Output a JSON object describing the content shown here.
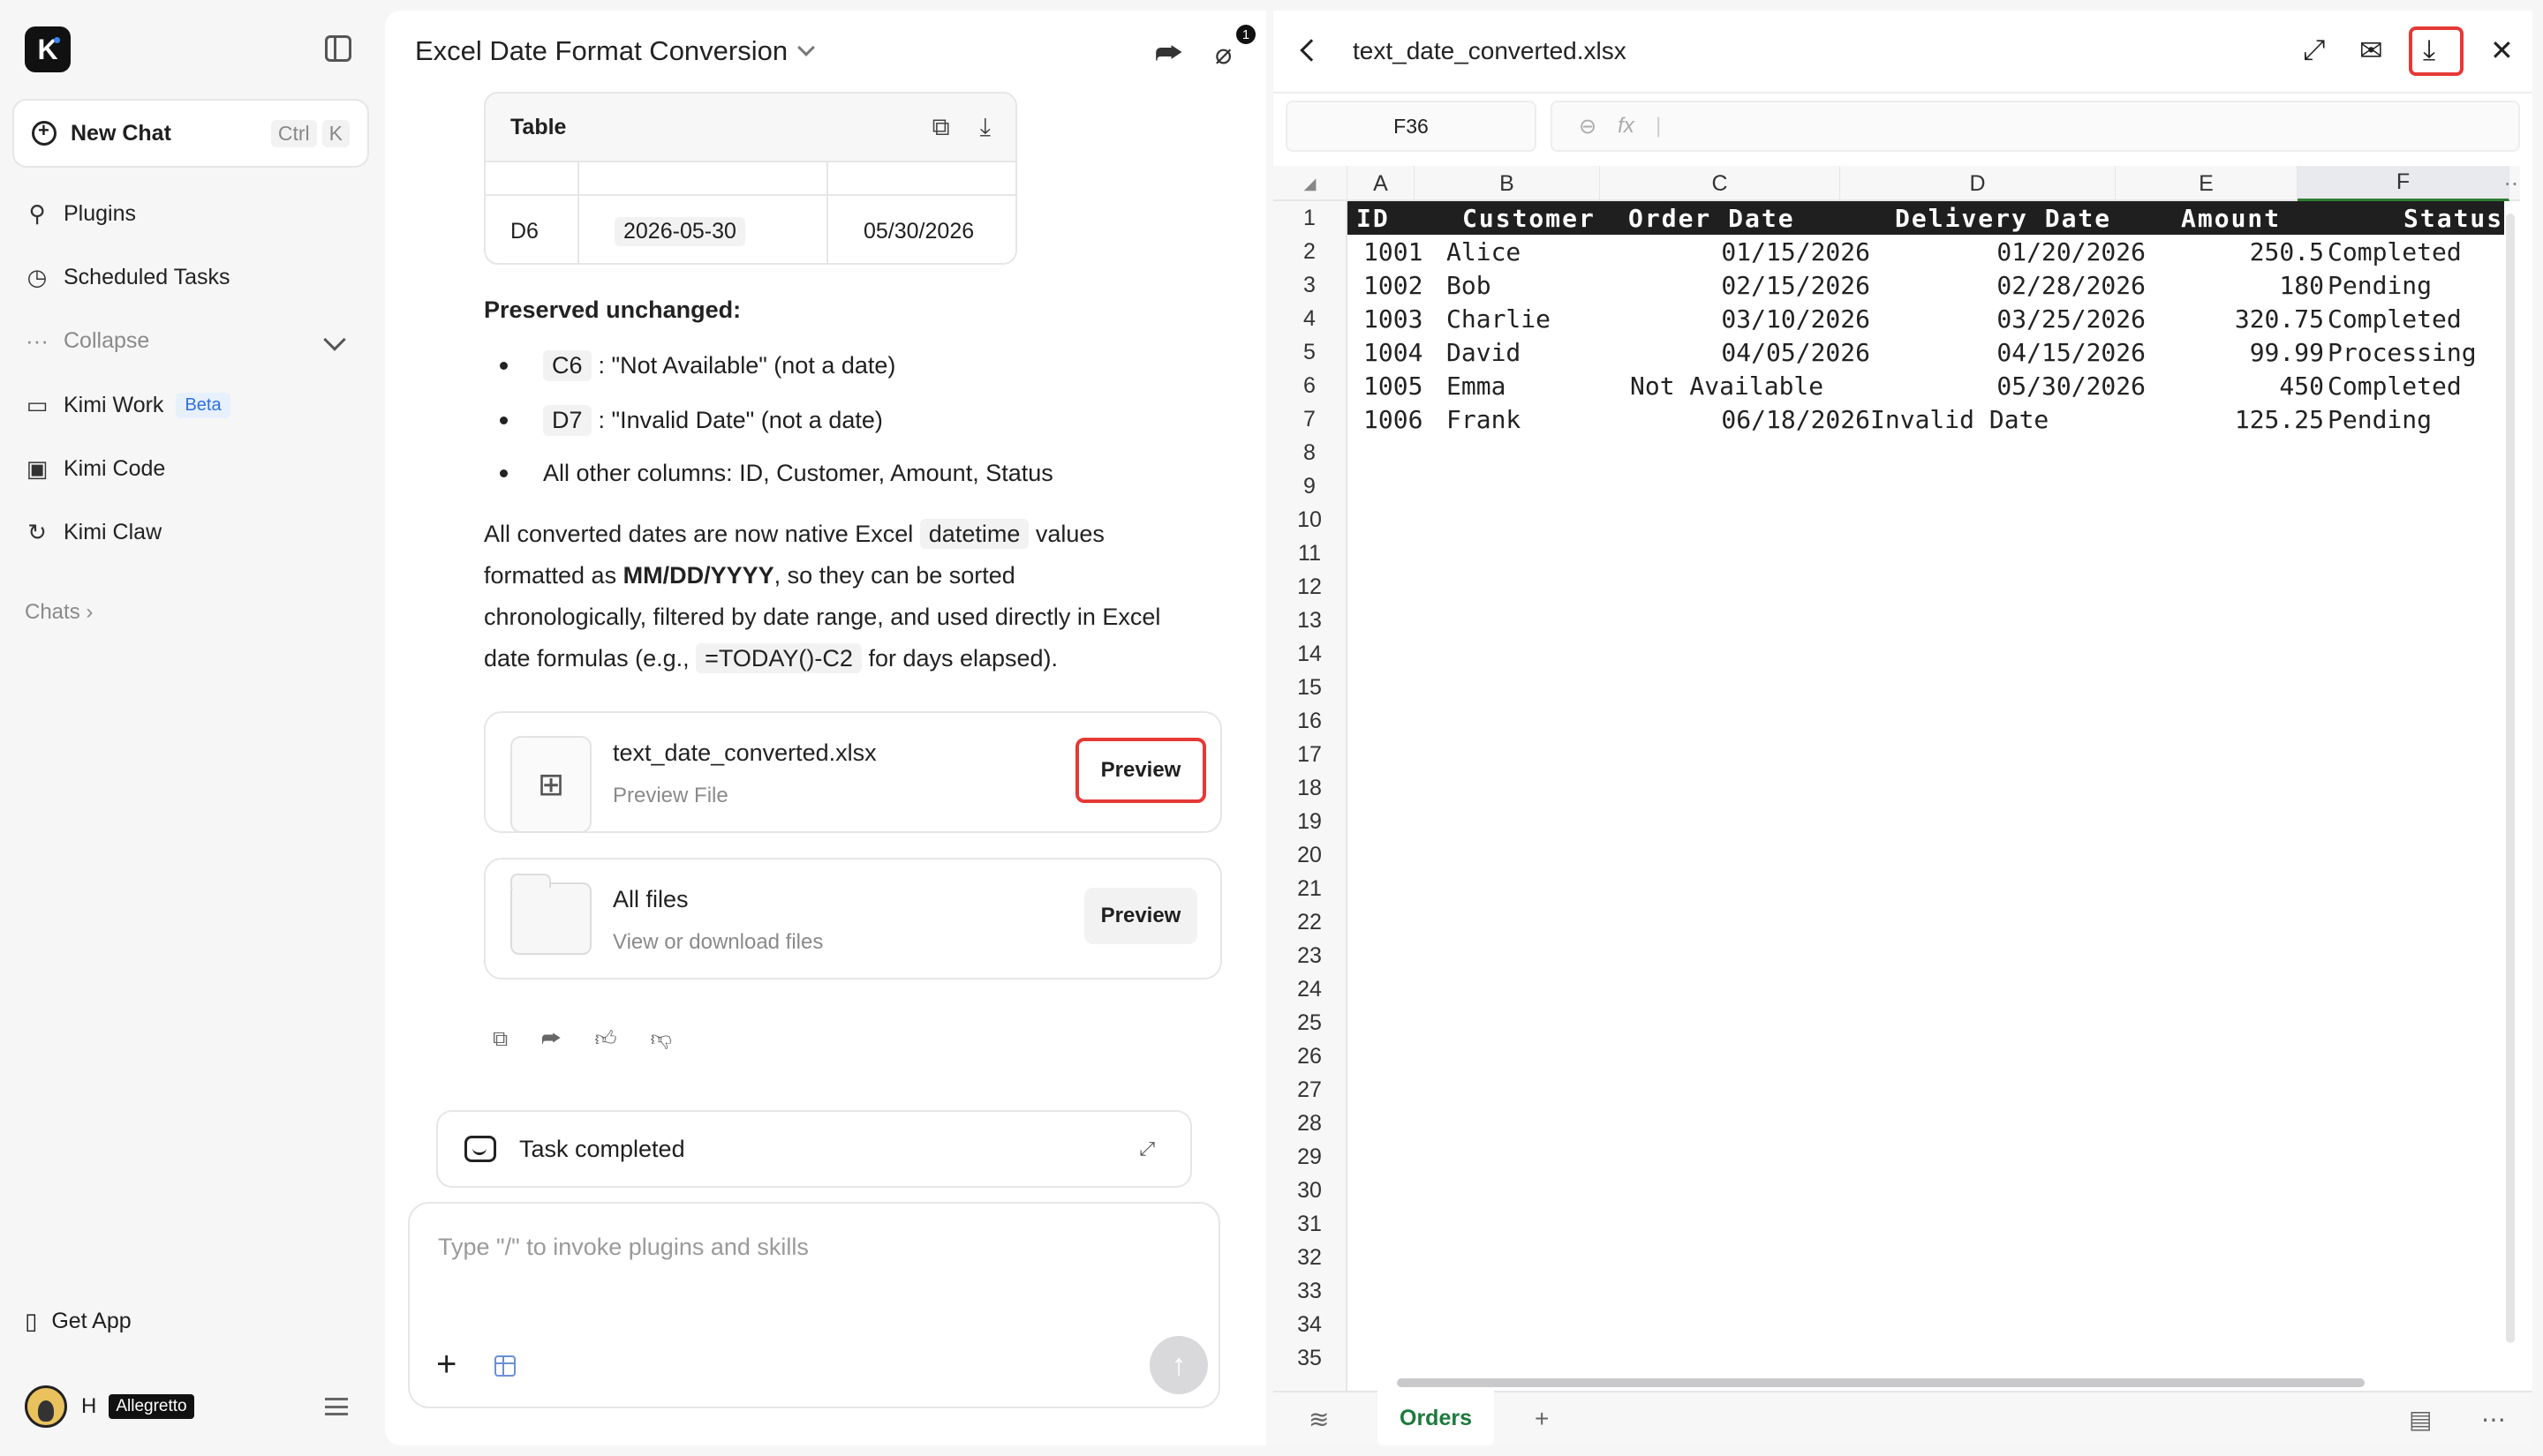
{
  "sidebar": {
    "new_chat": "New Chat",
    "shortcut_ctrl": "Ctrl",
    "shortcut_key": "K",
    "items": [
      {
        "label": "Plugins",
        "icon": "plug-icon"
      },
      {
        "label": "Scheduled Tasks",
        "icon": "clock-icon"
      },
      {
        "label": "Collapse",
        "icon": "more-icon"
      },
      {
        "label": "Kimi Work",
        "icon": "monitor-icon",
        "badge": "Beta"
      },
      {
        "label": "Kimi Code",
        "icon": "terminal-icon"
      },
      {
        "label": "Kimi Claw",
        "icon": "claw-icon"
      }
    ],
    "chats": "Chats",
    "get_app": "Get App",
    "user_initial": "H",
    "user_tier": "Allegretto"
  },
  "chat": {
    "title": "Excel Date Format Conversion",
    "attachment_count": "1",
    "table_card": {
      "title": "Table",
      "row": {
        "cell": "D6",
        "original": "2026-05-30",
        "converted": "05/30/2026"
      }
    },
    "preserved_heading": "Preserved unchanged:",
    "bullets": [
      {
        "code": "C6",
        "text": ": \"Not Available\" (not a date)"
      },
      {
        "code": "D7",
        "text": ": \"Invalid Date\" (not a date)"
      },
      {
        "code": "",
        "text": "All other columns: ID, Customer, Amount, Status"
      }
    ],
    "para": {
      "p1": "All converted dates are now native Excel",
      "code1": "datetime",
      "p2": "values",
      "p3": "formatted as",
      "bold": "MM/DD/YYYY",
      "p4": ", so they can be sorted",
      "p5": "chronologically, filtered by date range, and used directly in Excel",
      "p6": "date formulas (e.g.,",
      "code2": "=TODAY()-C2",
      "p7": "for days elapsed)."
    },
    "file_card": {
      "name": "text_date_converted.xlsx",
      "sub": "Preview File",
      "button": "Preview"
    },
    "files_card": {
      "name": "All files",
      "sub": "View or download files",
      "button": "Preview"
    },
    "task_status": "Task completed",
    "input_placeholder": "Type \"/\" to invoke plugins and skills"
  },
  "panel": {
    "filename": "text_date_converted.xlsx",
    "cell_ref": "F36",
    "fx_label": "fx",
    "columns": [
      "A",
      "B",
      "C",
      "D",
      "E",
      "F"
    ],
    "row_numbers": [
      "1",
      "2",
      "3",
      "4",
      "5",
      "6",
      "7",
      "8",
      "9",
      "10",
      "11",
      "12",
      "13",
      "14",
      "15",
      "16",
      "17",
      "18",
      "19",
      "20",
      "21",
      "22",
      "23",
      "24",
      "25",
      "26",
      "27",
      "28",
      "29",
      "30",
      "31",
      "32",
      "33",
      "34",
      "35"
    ],
    "header": [
      "ID",
      "Customer",
      "Order Date",
      "Delivery Date",
      "Amount",
      "Status"
    ],
    "rows": [
      [
        "1001",
        "Alice",
        "01/15/2026",
        "01/20/2026",
        "250.5",
        "Completed"
      ],
      [
        "1002",
        "Bob",
        "02/15/2026",
        "02/28/2026",
        "180",
        "Pending"
      ],
      [
        "1003",
        "Charlie",
        "03/10/2026",
        "03/25/2026",
        "320.75",
        "Completed"
      ],
      [
        "1004",
        "David",
        "04/05/2026",
        "04/15/2026",
        "99.99",
        "Processing"
      ],
      [
        "1005",
        "Emma",
        "Not Available",
        "05/30/2026",
        "450",
        "Completed"
      ],
      [
        "1006",
        "Frank",
        "06/18/2026",
        "Invalid Date",
        "125.25",
        "Pending"
      ]
    ],
    "sheet_tab": "Orders"
  }
}
